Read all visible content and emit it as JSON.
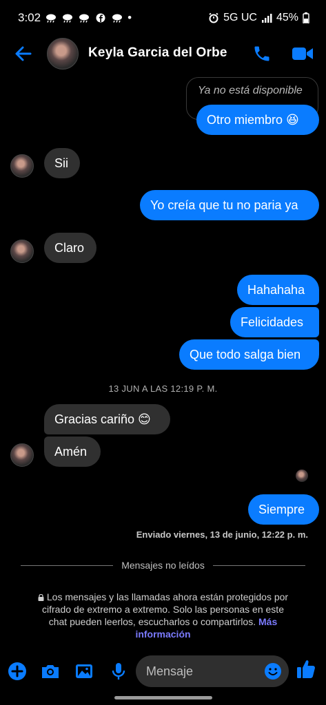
{
  "status": {
    "time": "3:02",
    "dot": "•",
    "network": "5G UC",
    "battery": "45%"
  },
  "header": {
    "contact_name": "Keyla Garcia del Orbe"
  },
  "colors": {
    "accent": "#0a7cff",
    "incoming_bubble": "#303030",
    "background": "#000000",
    "link": "#7b7bff"
  },
  "messages": {
    "reply_preview": "Ya no está disponible",
    "m1": "Otro miembro 😆",
    "m2": "Sii",
    "m3": "Yo creía que tu no paria ya",
    "m4": "Claro",
    "m5": "Hahahaha",
    "m6": "Felicidades",
    "m7": "Que todo salga bien",
    "timestamp": "13 JUN A LAS 12:19 P. M.",
    "m8": "Gracias cariño 😊",
    "m9": "Amén",
    "m10": "Siempre",
    "sent_info": "Enviado viernes, 13 de junio, 12:22 p. m."
  },
  "unread_divider": "Mensajes no leídos",
  "encryption": {
    "text": "Los mensajes y las llamadas ahora están protegidos por cifrado de extremo a extremo. Solo las personas en este chat pueden leerlos, escucharlos o compartirlos.",
    "link": "Más información"
  },
  "composer": {
    "placeholder": "Mensaje"
  },
  "icons": [
    "back-arrow-icon",
    "phone-icon",
    "video-camera-icon",
    "plus-icon",
    "camera-icon",
    "gallery-icon",
    "microphone-icon",
    "emoji-icon",
    "thumbs-up-icon",
    "lock-icon"
  ]
}
